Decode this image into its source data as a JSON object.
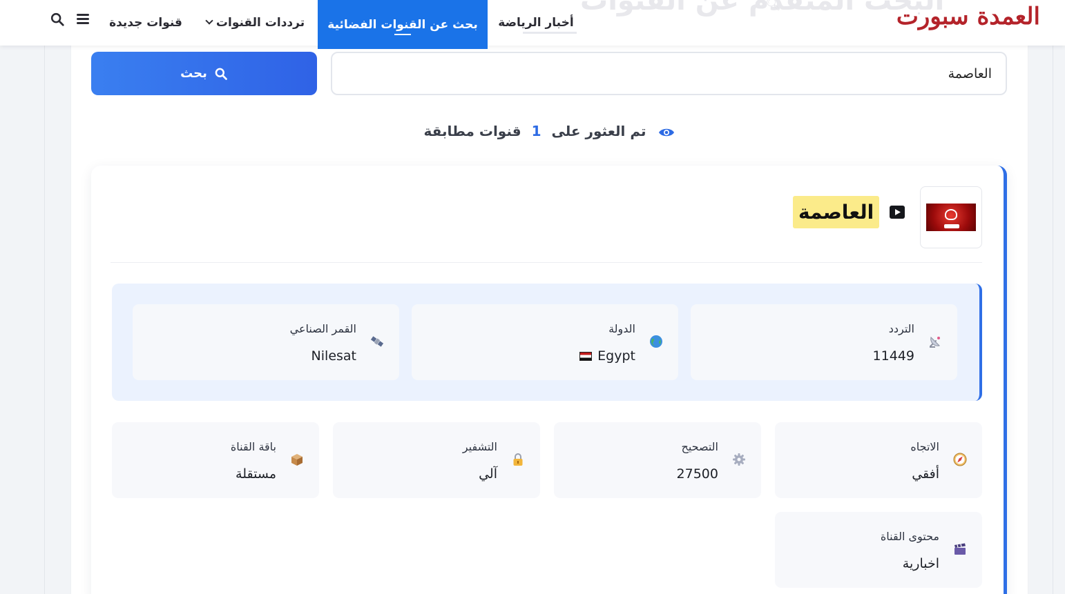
{
  "header": {
    "logo_text": "العمدة سبورت",
    "ghost_title": "البحث المتقدم عن القنوات",
    "nav": {
      "sports_news": "أخبار الرياضة",
      "search_channels": "بحث عن القنوات الفضائية",
      "channel_frequencies": "ترددات القنوات",
      "new_channels": "قنوات جديدة"
    },
    "icons": [
      "menu-icon",
      "search-icon"
    ]
  },
  "search": {
    "query": "العاصمة",
    "button_label": "بحث"
  },
  "results": {
    "prefix": "تم العثور على",
    "count": "1",
    "suffix": "قنوات مطابقة"
  },
  "channel": {
    "name": "العاصمة",
    "frequency": {
      "label": "التردد",
      "value": "11449",
      "icon": "satellite-dish-icon"
    },
    "country": {
      "label": "الدولة",
      "value": "Egypt",
      "icon": "globe-icon",
      "flag": "egypt-flag-icon"
    },
    "satellite": {
      "label": "القمر الصناعي",
      "value": "Nilesat",
      "icon": "satellite-icon"
    },
    "polarization": {
      "label": "الاتجاه",
      "value": "أفقي",
      "icon": "compass-icon"
    },
    "symbol_rate": {
      "label": "التصحيح",
      "value": "27500",
      "icon": "gear-icon"
    },
    "encryption": {
      "label": "التشفير",
      "value": "آلي",
      "icon": "lock-icon"
    },
    "package": {
      "label": "باقة القناة",
      "value": "مستقلة",
      "icon": "package-icon"
    },
    "content": {
      "label": "محتوى القناة",
      "value": "اخبارية",
      "icon": "clapper-icon"
    }
  },
  "colors": {
    "brand_red": "#b4232a",
    "accent_blue": "#1a73e8",
    "button_blue": "#2f62e6",
    "highlight_yellow": "#fbeb8a",
    "panel_blue": "#ebf2fe"
  }
}
